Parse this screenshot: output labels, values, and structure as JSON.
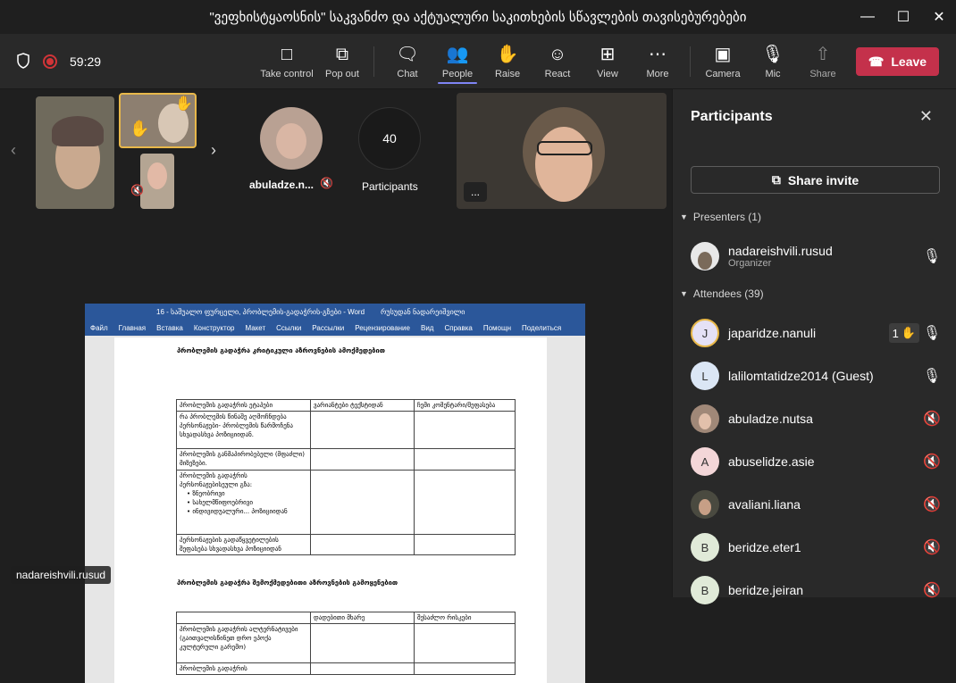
{
  "window": {
    "title": "\"ვეფხისტყაოსნის\" საკვანძო და აქტუალური საკითხების სწავლების თავისებურებები",
    "minimize_icon": "minimize-icon",
    "maximize_icon": "maximize-icon",
    "close_icon": "close-icon"
  },
  "toolbar": {
    "timer": "59:29",
    "buttons": [
      {
        "label": "Take control",
        "icon": "take-control-icon"
      },
      {
        "label": "Pop out",
        "icon": "pop-out-icon"
      },
      {
        "label": "Chat",
        "icon": "chat-icon"
      },
      {
        "label": "People",
        "icon": "people-icon"
      },
      {
        "label": "Raise",
        "icon": "raise-hand-icon"
      },
      {
        "label": "React",
        "icon": "react-icon"
      },
      {
        "label": "View",
        "icon": "view-icon"
      },
      {
        "label": "More",
        "icon": "more-icon"
      },
      {
        "label": "Camera",
        "icon": "camera-icon"
      },
      {
        "label": "Mic",
        "icon": "mic-icon"
      },
      {
        "label": "Share",
        "icon": "share-icon"
      }
    ],
    "leave_label": "Leave",
    "accent": "#7f85f5",
    "leave_color": "#c4314b"
  },
  "stage": {
    "strip_user_name": "abuladze.n...",
    "participant_count": "40",
    "participant_count_label": "Participants",
    "presenter_tag": "nadareishvili.rusud",
    "more_label": "..."
  },
  "document": {
    "window_title": "16 - საშუალო ფურცელი, პრობლემის-გადაჭრის-გზები - Word",
    "account": "რუსუდან ნადარეიშვილი",
    "ribbon": [
      "Файл",
      "Главная",
      "Вставка",
      "Конструктор",
      "Макет",
      "Ссылки",
      "Рассылки",
      "Рецензирование",
      "Вид",
      "Справка",
      "Помощн",
      "Поделиться"
    ],
    "heading1": "პრობლემის გადაჭრა კრიტიკული აზროვნების ამოქმედებით",
    "table1_headers": [
      "პრობლემის გადაჭრის ეტაპები",
      "ვარიანტები ტექსტიდან",
      "ჩემი კომენტარი/შეფასება"
    ],
    "table1_rows": [
      "რა პრობლემის წინაშე აღმოჩნდება პერსონაჟები- პრობლემის წარმოჩენა სხვადასხვა პოზიციიდან.",
      "პრობლემის განმაპირობებელი (მფაძლი) მიზეზები.",
      "პრობლემის გადაჭრის პერსონაჟებისეული გზა:",
      "პერსონაჟების გადაწყვეტილების შეფასება სხვადასხვა პოზიციიდან"
    ],
    "table1_bullets": [
      "ზნეობრივი",
      "სახელმწიფოებრივი",
      "ინდივიდუალური... პოზიციიდან"
    ],
    "heading2": "პრობლემის გადაჭრა შემოქმედებითი აზროვნების გამოყენებით",
    "table2_headers": [
      "",
      "დადებითი მხარე",
      "შესაძლო რისკები"
    ],
    "table2_rows": [
      "პრობლემის გადაჭრის ალტერნატივები (გაითვალისწინეთ დრო ეპოქა კულტურული გარემო)",
      "პრობლემის გადაჭრის"
    ]
  },
  "panel": {
    "title": "Participants",
    "share_invite_label": "Share invite",
    "presenters_label": "Presenters (1)",
    "attendees_label": "Attendees (39)",
    "presenters": [
      {
        "name": "nadareishvili.rusud",
        "role": "Organizer",
        "mic": "mic-icon"
      }
    ],
    "attendees": [
      {
        "name": "japaridze.nanuli",
        "initial": "J",
        "hand_count": "1",
        "mic": "mic-icon"
      },
      {
        "name": "lalilomtatidze2014 (Guest)",
        "initial": "L",
        "mic": "mic-icon"
      },
      {
        "name": "abuladze.nutsa",
        "initial": "",
        "mic": "mic-off-icon"
      },
      {
        "name": "abuselidze.asie",
        "initial": "A",
        "mic": "mic-off-icon"
      },
      {
        "name": "avaliani.liana",
        "initial": "",
        "mic": "mic-off-icon"
      },
      {
        "name": "beridze.eter1",
        "initial": "B",
        "mic": "mic-off-icon"
      },
      {
        "name": "beridze.jeiran",
        "initial": "B",
        "mic": "mic-off-icon"
      }
    ]
  }
}
